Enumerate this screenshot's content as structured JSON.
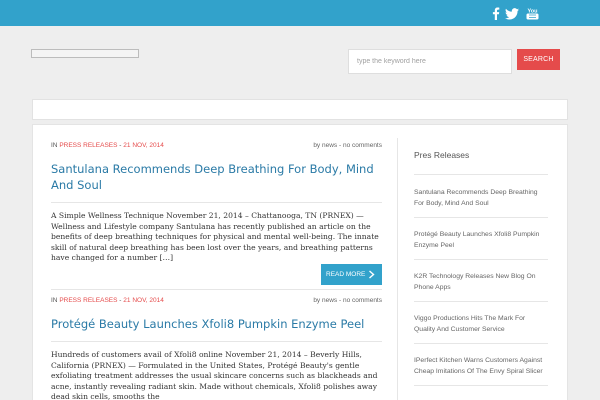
{
  "search": {
    "placeholder": "type the keyword here",
    "button_label": "SEARCH"
  },
  "social": {
    "icons": [
      "facebook-icon",
      "twitter-icon",
      "youtube-icon"
    ],
    "youtube_label": "You"
  },
  "posts": [
    {
      "in_label": "IN",
      "category": "PRESS RELEASES",
      "date": "21 NOV, 2014",
      "by": "by news",
      "comments": "no comments",
      "title": "Santulana Recommends Deep Breathing For Body, Mind And Soul",
      "excerpt": "A Simple Wellness Technique November 21, 2014 – Chattanooga, TN (PRNEX) — Wellness and Lifestyle company Santulana has recently published an article on the benefits of deep breathing techniques for physical and mental well-being. The innate skill of natural deep breathing has been lost over the years, and breathing patterns have changed for a number […]",
      "read_more": "READ MORE"
    },
    {
      "in_label": "IN",
      "category": "PRESS RELEASES",
      "date": "21 NOV, 2014",
      "by": "by news",
      "comments": "no comments",
      "title": "Protégé Beauty Launches Xfoli8 Pumpkin Enzyme Peel",
      "excerpt": "Hundreds of customers avail of Xfoli8 online November 21, 2014 – Beverly Hills, California (PRNEX) — Formulated in the United States, Protégé Beauty's gentle exfoliating treatment addresses the usual skincare concerns such as blackheads and acne, instantly revealing radiant skin. Made without chemicals, Xfoli8 polishes away dead skin cells, smooths the"
    }
  ],
  "sidebar": {
    "title": "Pres Releases",
    "items": [
      "Santulana Recommends Deep Breathing For Body, Mind And Soul",
      "Protégé Beauty Launches Xfoli8 Pumpkin Enzyme Peel",
      "K2R Technology Releases New Blog On Phone Apps",
      "Viggo Productions Hits The Mark For Quality And Customer Service",
      "IPerfect Kitchen Warns Customers Against Cheap Imitations Of The Envy Spiral Slicer"
    ]
  },
  "colors": {
    "topbar": "#32a2cb",
    "accent_red": "#e54b4b",
    "link_blue": "#2a7aa6"
  }
}
